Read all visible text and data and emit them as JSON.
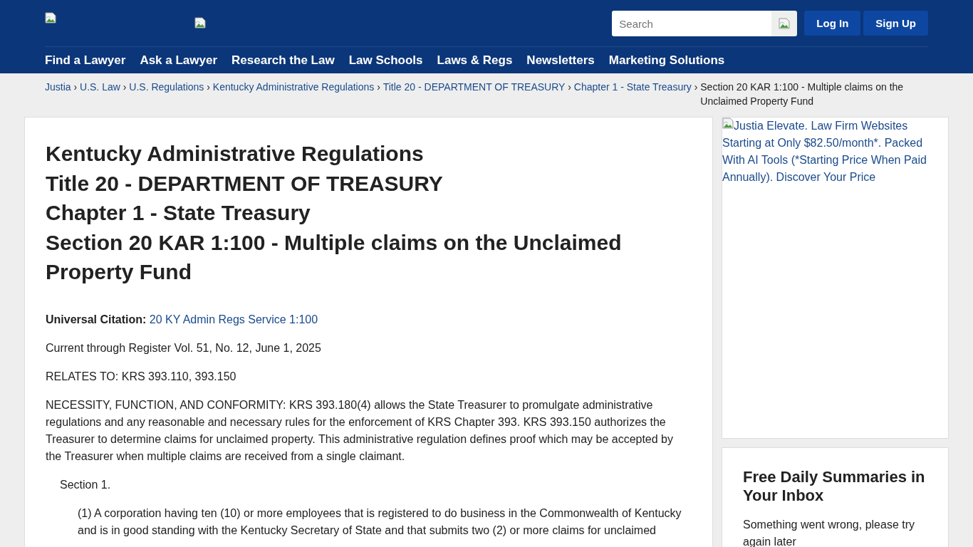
{
  "header": {
    "search": {
      "placeholder": "Search"
    },
    "buttons": [
      "Log In",
      "Sign Up"
    ],
    "nav": [
      "Find a Lawyer",
      "Ask a Lawyer",
      "Research the Law",
      "Law Schools",
      "Laws & Regs",
      "Newsletters",
      "Marketing Solutions"
    ]
  },
  "breadcrumb": {
    "separator": "›",
    "links": [
      "Justia",
      "U.S. Law",
      "U.S. Regulations",
      "Kentucky Administrative Regulations",
      "Title 20 - DEPARTMENT OF TREASURY",
      "Chapter 1 - State Treasury"
    ],
    "current": "Section 20 KAR 1:100 - Multiple claims on the Unclaimed Property Fund"
  },
  "article": {
    "title_lines": [
      "Kentucky Administrative Regulations",
      "Title 20 - DEPARTMENT OF TREASURY",
      "Chapter 1 - State Treasury",
      "Section 20 KAR 1:100 - Multiple claims on the Unclaimed Property Fund"
    ],
    "citation_label": "Universal Citation:",
    "citation_link": "20 KY Admin Regs Service 1:100",
    "paragraphs": [
      "Current through Register Vol. 51, No. 12, June 1, 2025",
      "RELATES TO: KRS 393.110, 393.150",
      "NECESSITY, FUNCTION, AND CONFORMITY: KRS 393.180(4) allows the State Treasurer to promulgate administrative regulations and any reasonable and necessary rules for the enforcement of KRS Chapter 393. KRS 393.150 authorizes the Treasurer to determine claims for unclaimed property. This administrative regulation defines proof which may be accepted by the Treasurer when multiple claims are received from a single claimant."
    ],
    "section_heading": "Section 1.",
    "subsection": "(1) A corporation having ten (10) or more employees that is registered to do business in the Commonwealth of Kentucky and is in good standing with the Kentucky Secretary of State and that submits two (2) or more claims for unclaimed"
  },
  "sidebar": {
    "ad_alt": "Justia Elevate. Law Firm Websites Starting at Only $82.50/month*. Packed With AI Tools (*Starting Price When Paid Annually). Discover Your Price",
    "newsletter_title": "Free Daily Summaries in Your Inbox",
    "newsletter_message": "Something went wrong, please try again later"
  }
}
